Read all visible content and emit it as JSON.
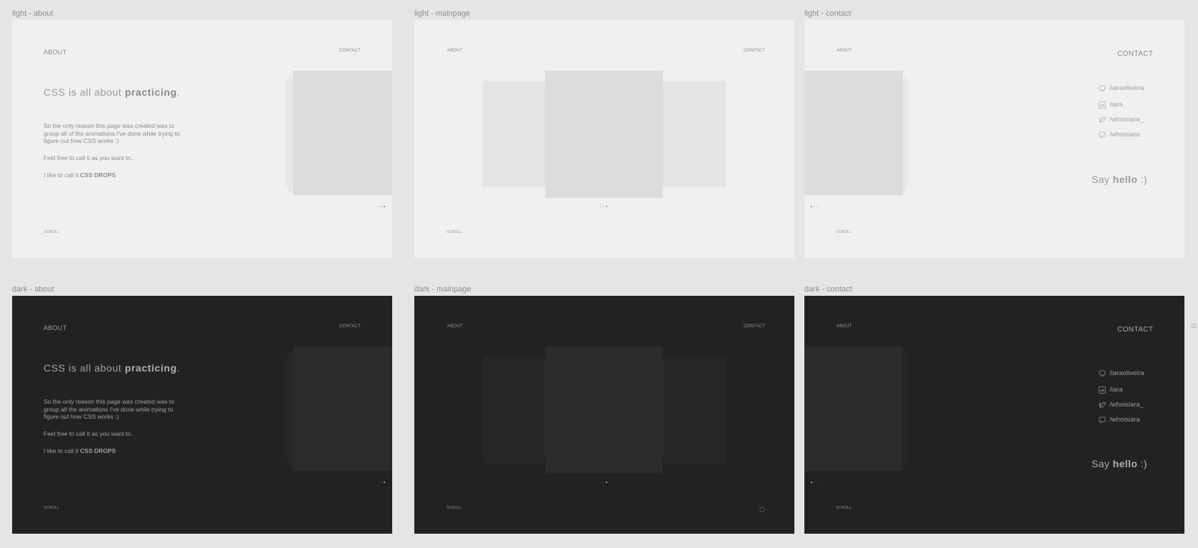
{
  "frames": {
    "light_about": {
      "label": "light - about",
      "nav_about": "ABOUT",
      "nav_contact": "CONTACT",
      "headline_pre": "CSS is all about ",
      "headline_bold": "practicing",
      "headline_post": ".",
      "paragraph1": "So the only reason this page was created was to group all of the animations I've done while trying to figure out how CSS works :)",
      "paragraph2": "Feel free to call it as you want to..",
      "paragraph3_pre": "I like to call it ",
      "paragraph3_bold": "CSS DROPS",
      "scroll": "SCROLL"
    },
    "light_mainpage": {
      "label": "light - mainpage",
      "nav_about": "ABOUT",
      "nav_contact": "CONTACT",
      "scroll": "SCROLL"
    },
    "light_contact": {
      "label": "light - contact",
      "nav_about": "ABOUT",
      "contact_title": "CONTACT",
      "socials": [
        {
          "icon": "github-icon",
          "handle": "/iaraoliveira"
        },
        {
          "icon": "linkedin-icon",
          "handle": "/iara"
        },
        {
          "icon": "twitter-icon",
          "handle": "/whoisiara_"
        },
        {
          "icon": "chat-icon",
          "handle": "/whoisiara"
        }
      ],
      "hello_pre": "Say ",
      "hello_bold": "hello",
      "hello_post": " :)",
      "scroll": "SCROLL"
    },
    "dark_about": {
      "label": "dark - about",
      "nav_about": "ABOUT",
      "nav_contact": "CONTACT",
      "headline_pre": "CSS is all about ",
      "headline_bold": "practicing",
      "headline_post": ".",
      "paragraph1": "So the only reason this page was created was to group all the animations I've done while trying to figure out how CSS works :)",
      "paragraph2": "Feel free to call it as you want to..",
      "paragraph3_pre": "I like to call it ",
      "paragraph3_bold": "CSS DROPS",
      "scroll": "SCROLL"
    },
    "dark_mainpage": {
      "label": "dark - mainpage",
      "nav_about": "ABOUT",
      "nav_contact": "CONTACT",
      "scroll": "SCROLL"
    },
    "dark_contact": {
      "label": "dark - contact",
      "nav_about": "ABOUT",
      "contact_title": "CONTACT",
      "socials": [
        {
          "icon": "github-icon",
          "handle": "/iaraoliveira"
        },
        {
          "icon": "linkedin-icon",
          "handle": "/iara"
        },
        {
          "icon": "twitter-icon",
          "handle": "/whoisiara_"
        },
        {
          "icon": "chat-icon",
          "handle": "/whoisiara"
        }
      ],
      "hello_pre": "Say ",
      "hello_bold": "hello",
      "hello_post": " :)",
      "scroll": "SCROLL"
    }
  },
  "colors": {
    "canvas": "#e5e5e5",
    "light_bg": "#f0f0f0",
    "dark_bg": "#222222"
  }
}
